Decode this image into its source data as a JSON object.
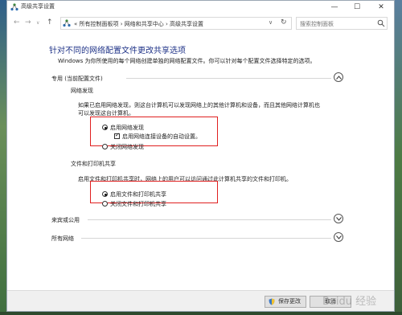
{
  "window": {
    "title": "高级共享设置",
    "minimize_symbol": "—",
    "maximize_symbol": "☐",
    "close_symbol": "✕"
  },
  "address_bar": {
    "back_symbol": "←",
    "forward_symbol": "→",
    "up_symbol": "↑",
    "recent_symbol": "∨",
    "path": "« 所有控制面板项 › 网络和共享中心 › 高级共享设置",
    "dropdown_symbol": "∨",
    "refresh_symbol": "↻",
    "search_placeholder": "搜索控制面板"
  },
  "main": {
    "heading": "针对不同的网络配置文件更改共享选项",
    "description": "Windows 为你所使用的每个网络创建单独的网络配置文件。你可以针对每个配置文件选择特定的选项。",
    "profile_private": {
      "label": "专用 (当前配置文件)",
      "expanded": true
    },
    "network_discovery": {
      "label": "网络发现",
      "description_line1": "如果已启用网络发现，则这台计算机可以发现网络上的其他计算机和设备，而且其他网络计算机也",
      "description_line2": "可以发现这台计算机。",
      "option_on": "启用网络发现",
      "option_auto": "启用网络连接设备的自动设置。",
      "option_off": "关闭网络发现",
      "selected": "on",
      "auto_setup_checked": true
    },
    "file_printer_sharing": {
      "label": "文件和打印机共享",
      "description": "启用文件和打印机共享时，网络上的用户可以访问通过此计算机共享的文件和打印机。",
      "option_on": "启用文件和打印机共享",
      "option_off": "关闭文件和打印机共享",
      "selected": "on"
    },
    "profile_guest": {
      "label": "来宾或公用",
      "expanded": false
    },
    "profile_all": {
      "label": "所有网络",
      "expanded": false
    }
  },
  "footer": {
    "save_label": "保存更改",
    "cancel_label": "取消",
    "watermark": "Baidu 经验"
  },
  "colors": {
    "heading": "#1e3287",
    "highlight_box": "#e02020"
  }
}
